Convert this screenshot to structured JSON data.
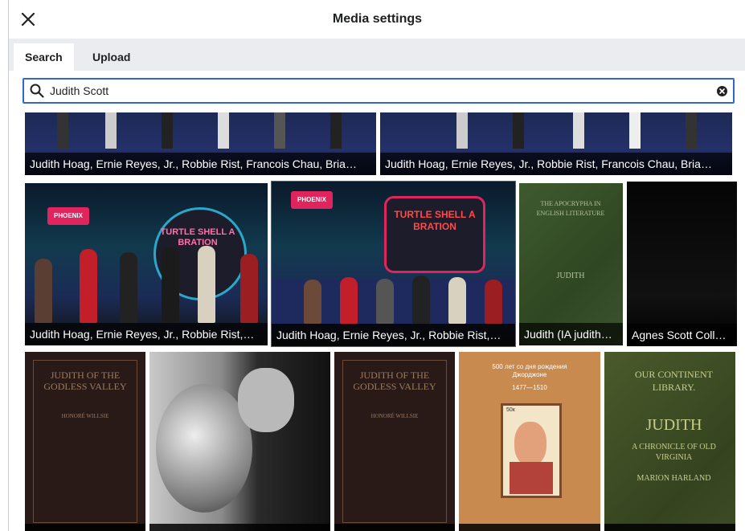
{
  "dialog": {
    "title": "Media settings",
    "close_icon": "close-icon"
  },
  "tabs": [
    {
      "label": "Search",
      "active": true
    },
    {
      "label": "Upload",
      "active": false
    }
  ],
  "search": {
    "value": "Judith Scott",
    "search_icon": "search-icon",
    "clear_icon": "clear-icon"
  },
  "results": {
    "row1": [
      {
        "caption": "Judith Hoag, Ernie Reyes, Jr., Robbie Rist, Francois Chau, Bria…"
      },
      {
        "caption": "Judith Hoag, Ernie Reyes, Jr., Robbie Rist, Francois Chau, Bria…"
      }
    ],
    "row2": [
      {
        "caption": "Judith Hoag, Ernie Reyes, Jr., Robbie Rist,…",
        "selected": false
      },
      {
        "caption": "Judith Hoag, Ernie Reyes, Jr., Robbie Rist,…",
        "selected": true
      },
      {
        "caption": "Judith (IA judith…"
      },
      {
        "caption": "Agnes Scott Coll…"
      }
    ],
    "row2_art": {
      "panel_logo_left": "PHOENIX",
      "panel_sign": "TURTLE SHELL A BRATION",
      "apocrypha_title": "THE APOCRYPHA IN ENGLISH LITERATURE",
      "apocrypha_sub": "JUDITH"
    },
    "row3_art": {
      "book1_title": "JUDITH OF THE GODLESS VALLEY",
      "book1_author": "HONORÉ WILLSIE",
      "stamp_top": "500 лет со дня рождения Джорджоне",
      "stamp_years": "1477—1510",
      "stamp_value": "50к",
      "green_header": "OUR CONTINENT LIBRARY.",
      "green_title": "JUDITH",
      "green_sub": "A CHRONICLE OF OLD VIRGINIA",
      "green_author": "MARION HARLAND"
    }
  },
  "colors": {
    "accent": "#3366cc",
    "border": "#c8ccd1",
    "tabbar": "#eaecf0",
    "caption_bg": "rgba(0,0,0,0.68)"
  }
}
